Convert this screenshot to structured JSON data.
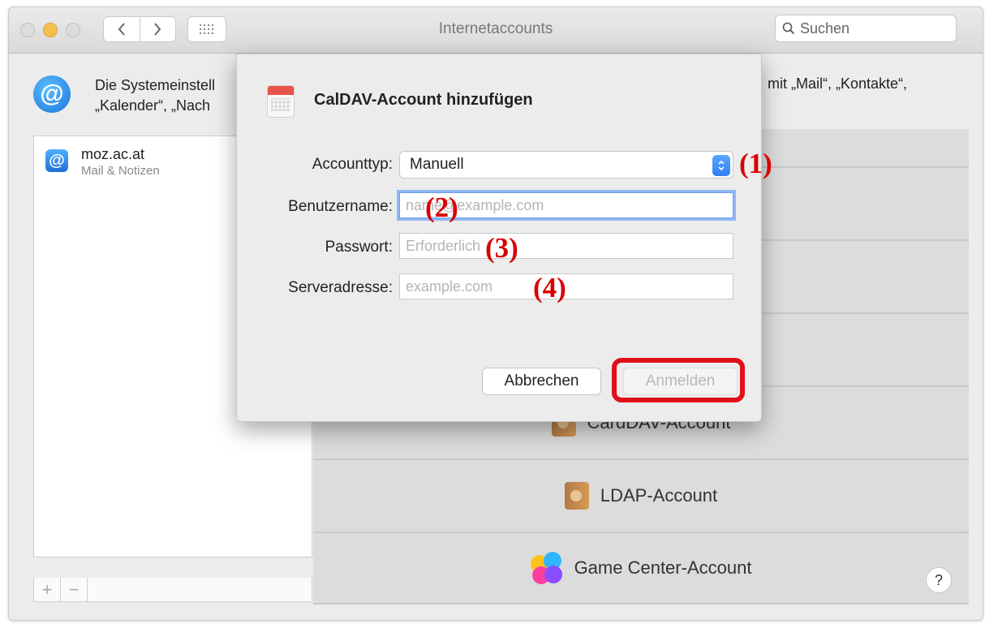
{
  "window": {
    "title": "Internetaccounts",
    "search_placeholder": "Suchen"
  },
  "header": {
    "text_left_line1": "Die Systemeinstell",
    "text_left_line2": "„Kalender“, „Nach",
    "text_right": "mit „Mail“, „Kontakte“,"
  },
  "sidebar": {
    "accounts": [
      {
        "name": "moz.ac.at",
        "subtitle": "Mail & Notizen"
      }
    ],
    "add_label": "+",
    "remove_label": "−"
  },
  "account_types": {
    "cardDAV": "CardDAV-Account",
    "ldap": "LDAP-Account",
    "game_center": "Game Center-Account"
  },
  "help_label": "?",
  "dialog": {
    "title": "CalDAV-Account hinzufügen",
    "fields": {
      "account_type": {
        "label": "Accounttyp:",
        "value": "Manuell"
      },
      "username": {
        "label": "Benutzername:",
        "placeholder": "name@example.com"
      },
      "password": {
        "label": "Passwort:",
        "placeholder": "Erforderlich"
      },
      "server": {
        "label": "Serveradresse:",
        "placeholder": "example.com"
      }
    },
    "cancel_label": "Abbrechen",
    "login_label": "Anmelden"
  },
  "annotations": [
    "(1)",
    "(2)",
    "(3)",
    "(4)"
  ],
  "colors": {
    "annotation": "#d90000",
    "highlight": "#e0101a",
    "accent": "#2f7ef5"
  }
}
